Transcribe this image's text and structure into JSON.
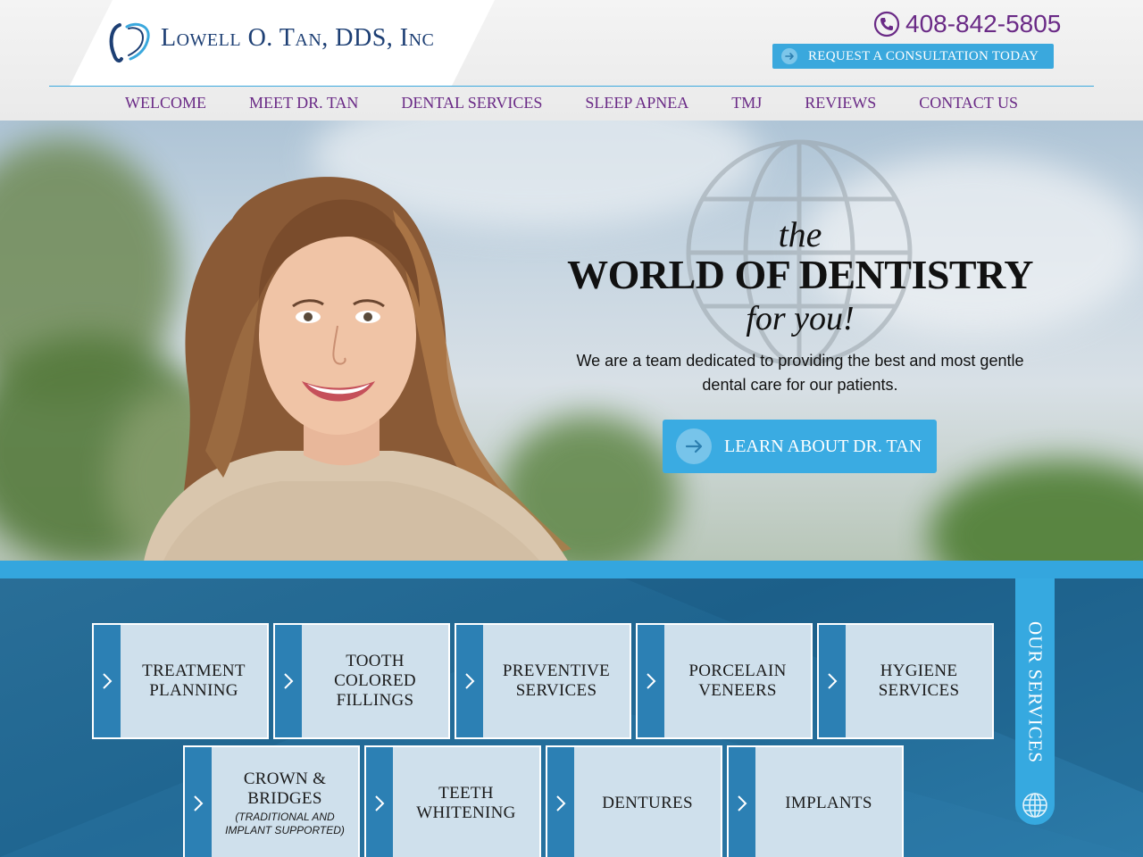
{
  "header": {
    "logo_text": "Lowell O. Tan, DDS, Inc",
    "phone": "408-842-5805",
    "consult_label": "REQUEST A CONSULTATION TODAY"
  },
  "nav": {
    "items": [
      "WELCOME",
      "MEET DR. TAN",
      "DENTAL SERVICES",
      "SLEEP APNEA",
      "TMJ",
      "REVIEWS",
      "CONTACT US"
    ]
  },
  "hero": {
    "the": "the",
    "title": "WORLD OF DENTISTRY",
    "for_you": "for you!",
    "description": "We are a team dedicated to providing the best and most gentle dental care for our patients.",
    "cta_label": "LEARN ABOUT DR. TAN"
  },
  "services": {
    "side_label": "OUR SERVICES",
    "row1": [
      {
        "lines": [
          "TREATMENT",
          "PLANNING"
        ]
      },
      {
        "lines": [
          "TOOTH",
          "COLORED",
          "FILLINGS"
        ]
      },
      {
        "lines": [
          "PREVENTIVE",
          "SERVICES"
        ]
      },
      {
        "lines": [
          "PORCELAIN",
          "VENEERS"
        ]
      },
      {
        "lines": [
          "HYGIENE",
          "SERVICES"
        ]
      }
    ],
    "row2": [
      {
        "lines": [
          "CROWN &",
          "BRIDGES"
        ],
        "sub": "(TRADITIONAL AND IMPLANT SUPPORTED)"
      },
      {
        "lines": [
          "TEETH",
          "WHITENING"
        ]
      },
      {
        "lines": [
          "DENTURES"
        ]
      },
      {
        "lines": [
          "IMPLANTS"
        ]
      }
    ]
  },
  "colors": {
    "brand_purple": "#6a2a86",
    "brand_navy": "#1d3f74",
    "accent_blue": "#3aa8dd",
    "services_bg": "#1f6590"
  }
}
